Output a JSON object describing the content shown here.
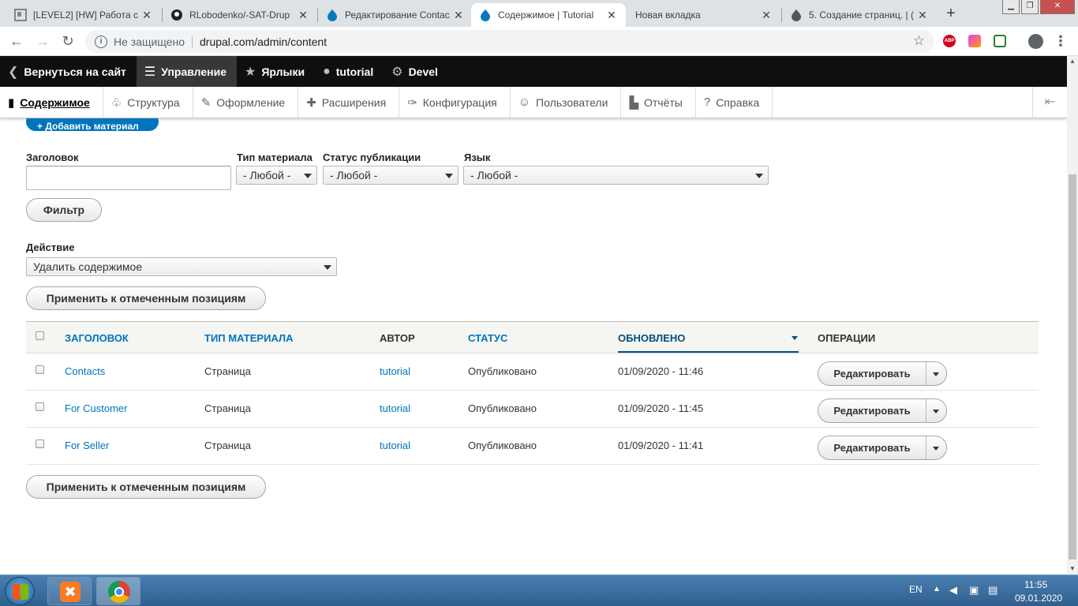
{
  "browser": {
    "tabs": [
      {
        "title": "[LEVEL2] [HW] Работа с т",
        "icon": "level2-favicon"
      },
      {
        "title": "RLobodenko/-SAT-Drup",
        "icon": "github-icon"
      },
      {
        "title": "Редактирование Contac",
        "icon": "drupal-icon"
      },
      {
        "title": "Содержимое | Tutorial",
        "icon": "drupal-icon"
      },
      {
        "title": "Новая вкладка",
        "icon": "none"
      },
      {
        "title": "5. Создание страниц. | (",
        "icon": "drupal-icon"
      }
    ],
    "new_tab": "+",
    "address": {
      "security": "Не защищено",
      "url": "drupal.com/admin/content"
    },
    "extensions": [
      "ABP"
    ]
  },
  "toolbar": {
    "items": [
      {
        "label": "Вернуться на сайт",
        "icon": "chevron-left-circle-icon"
      },
      {
        "label": "Управление",
        "icon": "hamburger-icon"
      },
      {
        "label": "Ярлыки",
        "icon": "star-icon"
      },
      {
        "label": "tutorial",
        "icon": "user-icon"
      },
      {
        "label": "Devel",
        "icon": "gear-icon"
      }
    ]
  },
  "tray": {
    "items": [
      {
        "label": "Содержимое",
        "icon": "file-icon"
      },
      {
        "label": "Структура",
        "icon": "structure-icon"
      },
      {
        "label": "Оформление",
        "icon": "brush-icon"
      },
      {
        "label": "Расширения",
        "icon": "puzzle-icon"
      },
      {
        "label": "Конфигурация",
        "icon": "wrench-icon"
      },
      {
        "label": "Пользователи",
        "icon": "people-icon"
      },
      {
        "label": "Отчёты",
        "icon": "bars-icon"
      },
      {
        "label": "Справка",
        "icon": "help-icon"
      }
    ]
  },
  "content": {
    "add_button": "+ Добавить материал",
    "filters": {
      "title_label": "Заголовок",
      "title_value": "",
      "type_label": "Тип материала",
      "type_value": "- Любой -",
      "status_label": "Статус публикации",
      "status_value": "- Любой -",
      "lang_label": "Язык",
      "lang_value": "- Любой -",
      "filter_button": "Фильтр"
    },
    "action": {
      "label": "Действие",
      "value": "Удалить содержимое",
      "apply_button": "Применить к отмеченным позициям"
    },
    "table": {
      "headers": [
        "ЗАГОЛОВОК",
        "ТИП МАТЕРИАЛА",
        "АВТОР",
        "СТАТУС",
        "ОБНОВЛЕНО",
        "ОПЕРАЦИИ"
      ],
      "rows": [
        {
          "title": "Contacts",
          "type": "Страница",
          "author": "tutorial",
          "status": "Опубликовано",
          "updated": "01/09/2020 - 11:46",
          "op": "Редактировать"
        },
        {
          "title": "For Customer",
          "type": "Страница",
          "author": "tutorial",
          "status": "Опубликовано",
          "updated": "01/09/2020 - 11:45",
          "op": "Редактировать"
        },
        {
          "title": "For Seller",
          "type": "Страница",
          "author": "tutorial",
          "status": "Опубликовано",
          "updated": "01/09/2020 - 11:41",
          "op": "Редактировать"
        }
      ]
    },
    "apply_bottom": "Применить к отмеченным позициям"
  },
  "taskbar": {
    "lang": "EN",
    "time": "11:55",
    "date": "09.01.2020"
  },
  "colors": {
    "link": "#0074bd",
    "toolbar_bg": "#0f0f0f",
    "add_button_bg": "#0074bd"
  }
}
